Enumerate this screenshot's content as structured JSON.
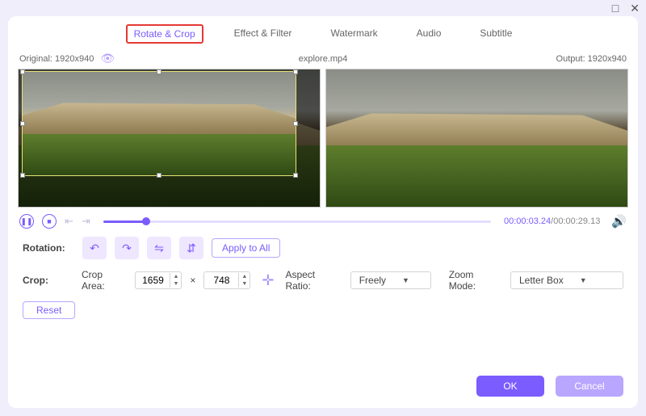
{
  "titlebar": {
    "max": "□",
    "close": "✕"
  },
  "tabs": [
    "Rotate & Crop",
    "Effect & Filter",
    "Watermark",
    "Audio",
    "Subtitle"
  ],
  "active_tab_index": 0,
  "info": {
    "original_label": "Original: 1920x940",
    "filename": "explore.mp4",
    "output_label": "Output: 1920x940"
  },
  "playback": {
    "current": "00:00:03.24",
    "total": "/00:00:29.13"
  },
  "rotation": {
    "label": "Rotation:",
    "apply_all": "Apply to All"
  },
  "crop": {
    "label": "Crop:",
    "area_label": "Crop Area:",
    "width": "1659",
    "sep": "×",
    "height": "748",
    "aspect_label": "Aspect Ratio:",
    "aspect_value": "Freely",
    "zoom_label": "Zoom Mode:",
    "zoom_value": "Letter Box",
    "reset": "Reset"
  },
  "footer": {
    "ok": "OK",
    "cancel": "Cancel"
  }
}
